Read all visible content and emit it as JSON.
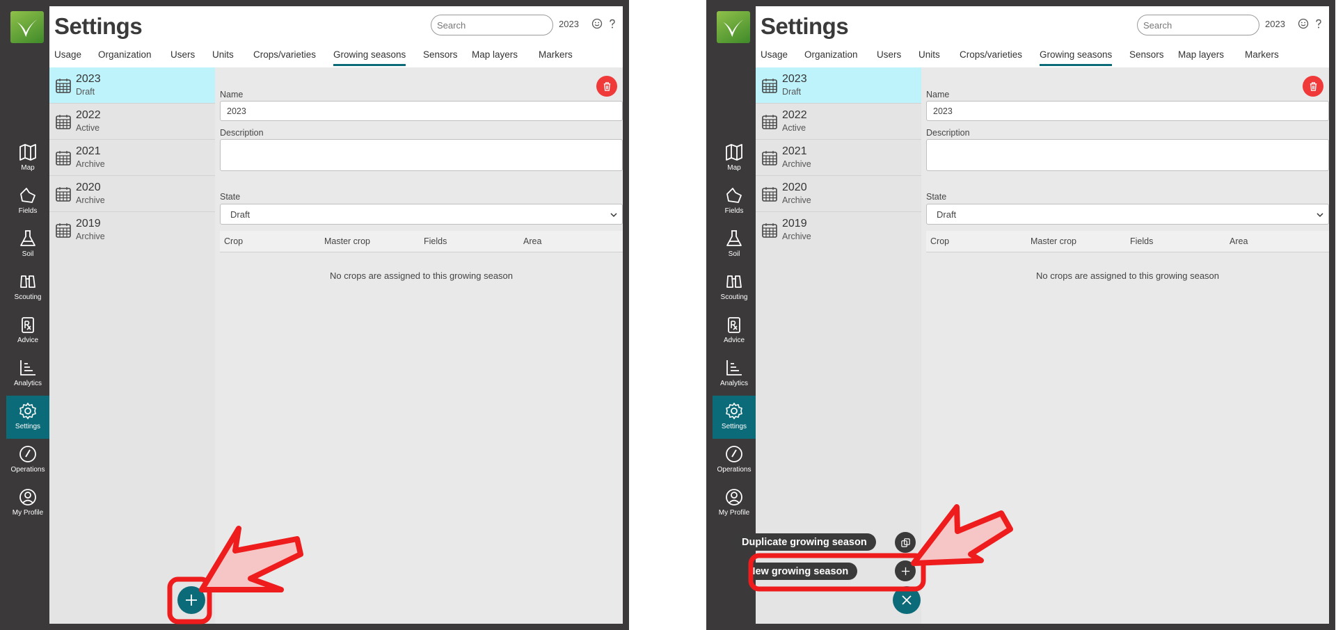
{
  "app": {
    "title": "Settings",
    "search_placeholder": "Search",
    "current_year": "2023",
    "header_icons": [
      "smiley-icon",
      "help-icon"
    ]
  },
  "sidebar": {
    "items": [
      {
        "label": "Map",
        "icon": "map-icon"
      },
      {
        "label": "Fields",
        "icon": "fields-icon"
      },
      {
        "label": "Soil",
        "icon": "flask-icon"
      },
      {
        "label": "Scouting",
        "icon": "binoculars-icon"
      },
      {
        "label": "Advice",
        "icon": "prescription-icon"
      },
      {
        "label": "Analytics",
        "icon": "analytics-icon"
      },
      {
        "label": "Settings",
        "icon": "gear-icon",
        "active": true
      },
      {
        "label": "Operations",
        "icon": "gauge-icon"
      },
      {
        "label": "My Profile",
        "icon": "profile-icon"
      }
    ]
  },
  "tabs": [
    {
      "label": "Usage"
    },
    {
      "label": "Organization"
    },
    {
      "label": "Users"
    },
    {
      "label": "Units"
    },
    {
      "label": "Crops/varieties"
    },
    {
      "label": "Growing seasons",
      "active": true
    },
    {
      "label": "Sensors"
    },
    {
      "label": "Map layers"
    },
    {
      "label": "Markers"
    }
  ],
  "seasons": [
    {
      "year": "2023",
      "state": "Draft",
      "selected": true
    },
    {
      "year": "2022",
      "state": "Active"
    },
    {
      "year": "2021",
      "state": "Archive"
    },
    {
      "year": "2020",
      "state": "Archive"
    },
    {
      "year": "2019",
      "state": "Archive"
    }
  ],
  "detail": {
    "name_label": "Name",
    "name_value": "2023",
    "description_label": "Description",
    "description_value": "",
    "state_label": "State",
    "state_value": "Draft",
    "table_headers": [
      "Crop",
      "Master crop",
      "Fields",
      "Area"
    ],
    "empty_message": "No crops are assigned to this growing season"
  },
  "fab_menu": {
    "duplicate_label": "Duplicate growing season",
    "new_label": "New growing season"
  },
  "colors": {
    "accent": "#0c6b79",
    "selected_row": "#bff3fb",
    "delete": "#f03a3a",
    "annotation_red": "#ee1c1c",
    "annotation_fill": "#f6c6c6"
  }
}
